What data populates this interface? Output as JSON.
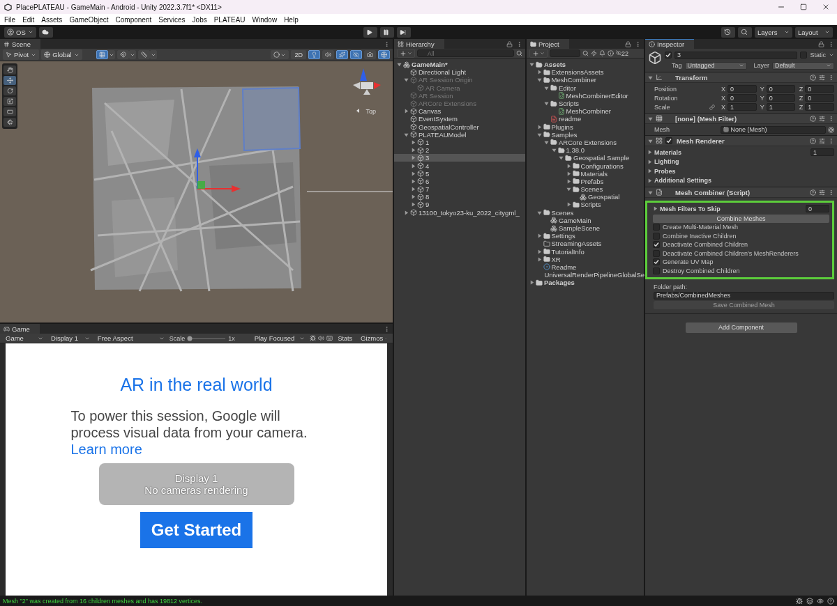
{
  "window": {
    "title": "PlacePLATEAU - GameMain - Android - Unity 2022.3.7f1* <DX11>"
  },
  "menu": [
    "File",
    "Edit",
    "Assets",
    "GameObject",
    "Component",
    "Services",
    "Jobs",
    "PLATEAU",
    "Window",
    "Help"
  ],
  "toolbar": {
    "account": "OS",
    "layers": "Layers",
    "layout": "Layout"
  },
  "scene": {
    "tab": "Scene",
    "pivot": "Pivot",
    "global": "Global",
    "snap_toggles": [
      {
        "kind": "grid",
        "on": true
      },
      {
        "kind": "snap",
        "on": false
      },
      {
        "kind": "increment",
        "on": false
      }
    ],
    "mode_2d": {
      "label": "2D",
      "on": false
    },
    "view_toggles": [
      {
        "kind": "shading",
        "on": false
      },
      {
        "kind": "lighting",
        "on": true
      },
      {
        "kind": "audio",
        "on": false
      },
      {
        "kind": "effects",
        "on": true
      },
      {
        "kind": "visibility",
        "on": true
      },
      {
        "kind": "camera",
        "on": false
      },
      {
        "kind": "gizmos",
        "on": true
      }
    ],
    "tools": [
      {
        "kind": "hand",
        "selected": false
      },
      {
        "kind": "move",
        "selected": true
      },
      {
        "kind": "rotate",
        "selected": false
      },
      {
        "kind": "scale",
        "selected": false
      },
      {
        "kind": "rect",
        "selected": false
      },
      {
        "kind": "transform",
        "selected": false
      }
    ],
    "orientation": "Top"
  },
  "game": {
    "tab": "Game",
    "view": "Game",
    "display": "Display 1",
    "aspect": "Free Aspect",
    "scale_label": "Scale",
    "scale_slider": {
      "level": 0
    },
    "scale": "1x",
    "play_mode": "Play Focused",
    "stats": "Stats",
    "gizmos": "Gizmos",
    "heading": "AR in the real world",
    "body": "To power this session, Google will process visual data from your camera.",
    "link": "Learn more",
    "overlay_title": "Display 1",
    "overlay_message": "No cameras rendering",
    "button": "Get Started"
  },
  "hierarchy": {
    "tab": "Hierarchy",
    "placeholder": "All",
    "items": [
      {
        "label": "GameMain*",
        "kind": "scene",
        "expanded": true,
        "disabled": false,
        "selected": false,
        "children": [
          {
            "label": "Directional Light",
            "kind": "object",
            "disabled": false,
            "selected": false
          },
          {
            "label": "AR Session Origin",
            "kind": "object",
            "expanded": true,
            "disabled": true,
            "selected": false,
            "children": [
              {
                "label": "AR Camera",
                "kind": "object",
                "disabled": true,
                "selected": false
              }
            ]
          },
          {
            "label": "AR Session",
            "kind": "object",
            "disabled": true,
            "selected": false
          },
          {
            "label": "ARCore Extensions",
            "kind": "object",
            "disabled": true,
            "selected": false
          },
          {
            "label": "Canvas",
            "kind": "object",
            "expanded": false,
            "disabled": false,
            "selected": false
          },
          {
            "label": "EventSystem",
            "kind": "object",
            "disabled": false,
            "selected": false
          },
          {
            "label": "GeospatialController",
            "kind": "object",
            "disabled": false,
            "selected": false
          },
          {
            "label": "PLATEAUModel",
            "kind": "object",
            "expanded": true,
            "disabled": false,
            "selected": false,
            "children": [
              {
                "label": "1",
                "kind": "object",
                "expanded": false,
                "disabled": false,
                "selected": false
              },
              {
                "label": "2",
                "kind": "object",
                "expanded": false,
                "disabled": false,
                "selected": false
              },
              {
                "label": "3",
                "kind": "object",
                "expanded": false,
                "disabled": false,
                "selected": true
              },
              {
                "label": "4",
                "kind": "object",
                "expanded": false,
                "disabled": false,
                "selected": false
              },
              {
                "label": "5",
                "kind": "object",
                "expanded": false,
                "disabled": false,
                "selected": false
              },
              {
                "label": "6",
                "kind": "object",
                "expanded": false,
                "disabled": false,
                "selected": false
              },
              {
                "label": "7",
                "kind": "object",
                "expanded": false,
                "disabled": false,
                "selected": false
              },
              {
                "label": "8",
                "kind": "object",
                "expanded": false,
                "disabled": false,
                "selected": false
              },
              {
                "label": "9",
                "kind": "object",
                "expanded": false,
                "disabled": false,
                "selected": false
              }
            ]
          },
          {
            "label": "13100_tokyo23-ku_2022_citygml_",
            "kind": "object",
            "expanded": false,
            "disabled": false,
            "selected": false
          }
        ]
      }
    ]
  },
  "project": {
    "tab": "Project",
    "hidden_count": "22",
    "items": [
      {
        "label": "Assets",
        "kind": "folder",
        "expanded": true,
        "children": [
          {
            "label": "ExtensionsAssets",
            "kind": "folder",
            "expanded": false
          },
          {
            "label": "MeshCombiner",
            "kind": "folder",
            "expanded": true,
            "children": [
              {
                "label": "Editor",
                "kind": "folder",
                "expanded": true,
                "children": [
                  {
                    "label": "MeshCombinerEditor",
                    "kind": "script"
                  }
                ]
              },
              {
                "label": "Scripts",
                "kind": "folder",
                "expanded": true,
                "children": [
                  {
                    "label": "MeshCombiner",
                    "kind": "script"
                  }
                ]
              },
              {
                "label": "readme",
                "kind": "text"
              }
            ]
          },
          {
            "label": "Plugins",
            "kind": "folder",
            "expanded": false
          },
          {
            "label": "Samples",
            "kind": "folder",
            "expanded": true,
            "children": [
              {
                "label": "ARCore Extensions",
                "kind": "folder",
                "expanded": true,
                "children": [
                  {
                    "label": "1.38.0",
                    "kind": "folder",
                    "expanded": true,
                    "children": [
                      {
                        "label": "Geospatial Sample",
                        "kind": "folder",
                        "expanded": true,
                        "children": [
                          {
                            "label": "Configurations",
                            "kind": "folder",
                            "expanded": false
                          },
                          {
                            "label": "Materials",
                            "kind": "folder",
                            "expanded": false
                          },
                          {
                            "label": "Prefabs",
                            "kind": "folder",
                            "expanded": false
                          },
                          {
                            "label": "Scenes",
                            "kind": "folder",
                            "expanded": true,
                            "children": [
                              {
                                "label": "Geospatial",
                                "kind": "scene"
                              }
                            ]
                          },
                          {
                            "label": "Scripts",
                            "kind": "folder",
                            "expanded": false
                          }
                        ]
                      }
                    ]
                  }
                ]
              }
            ]
          },
          {
            "label": "Scenes",
            "kind": "folder",
            "expanded": true,
            "children": [
              {
                "label": "GameMain",
                "kind": "scene"
              },
              {
                "label": "SampleScene",
                "kind": "scene"
              }
            ]
          },
          {
            "label": "Settings",
            "kind": "folder",
            "expanded": false
          },
          {
            "label": "StreamingAssets",
            "kind": "empty_folder"
          },
          {
            "label": "TutorialInfo",
            "kind": "folder",
            "expanded": false
          },
          {
            "label": "XR",
            "kind": "folder",
            "expanded": false
          },
          {
            "label": "Readme",
            "kind": "asset"
          },
          {
            "label": "UniversalRenderPipelineGlobalSe",
            "kind": "asset"
          }
        ]
      },
      {
        "label": "Packages",
        "kind": "folder",
        "expanded": false
      }
    ]
  },
  "inspector": {
    "tab": "Inspector",
    "object": {
      "name": "3",
      "active": true,
      "static_label": "Static",
      "static": false,
      "tag_label": "Tag",
      "tag": "Untagged",
      "layer_label": "Layer",
      "layer": "Default"
    },
    "components": [
      {
        "kind": "transform",
        "title": "Transform",
        "expanded": true,
        "rows": [
          {
            "label": "Position",
            "values": [
              {
                "axis": "X",
                "value": "0"
              },
              {
                "axis": "Y",
                "value": "0"
              },
              {
                "axis": "Z",
                "value": "0"
              }
            ]
          },
          {
            "label": "Rotation",
            "values": [
              {
                "axis": "X",
                "value": "0"
              },
              {
                "axis": "Y",
                "value": "0"
              },
              {
                "axis": "Z",
                "value": "0"
              }
            ]
          },
          {
            "label": "Scale",
            "linked": true,
            "values": [
              {
                "axis": "X",
                "value": "1"
              },
              {
                "axis": "Y",
                "value": "1"
              },
              {
                "axis": "Z",
                "value": "1"
              }
            ]
          }
        ]
      },
      {
        "kind": "mesh_filter",
        "title": "[none] (Mesh Filter)",
        "expanded": true,
        "field_label": "Mesh",
        "field_value": "None (Mesh)"
      },
      {
        "kind": "mesh_renderer",
        "title": "Mesh Renderer",
        "expanded": true,
        "enabled": true,
        "sections": [
          {
            "label": "Materials",
            "value": "1"
          },
          {
            "label": "Lighting"
          },
          {
            "label": "Probes"
          },
          {
            "label": "Additional Settings"
          }
        ]
      },
      {
        "kind": "script",
        "title": "Mesh Combiner (Script)",
        "expanded": true,
        "skip_label": "Mesh Filters To Skip",
        "skip_value": "0",
        "combine_button": "Combine Meshes",
        "options": [
          {
            "label": "Create Multi-Material Mesh",
            "checked": false
          },
          {
            "label": "Combine Inactive Children",
            "checked": false
          },
          {
            "label": "Deactivate Combined Children",
            "checked": true
          },
          {
            "label": "Deactivate Combined Children's MeshRenderers",
            "checked": false
          },
          {
            "label": "Generate UV Map",
            "checked": true
          },
          {
            "label": "Destroy Combined Children",
            "checked": false
          }
        ],
        "folder_label": "Folder path:",
        "folder_value": "Prefabs/CombinedMeshes",
        "save_button": "Save Combined Mesh"
      }
    ],
    "add_button": "Add Component"
  },
  "status_bar": {
    "message": "Mesh \"2\" was created from 16 children meshes and has 19812 vertices."
  }
}
